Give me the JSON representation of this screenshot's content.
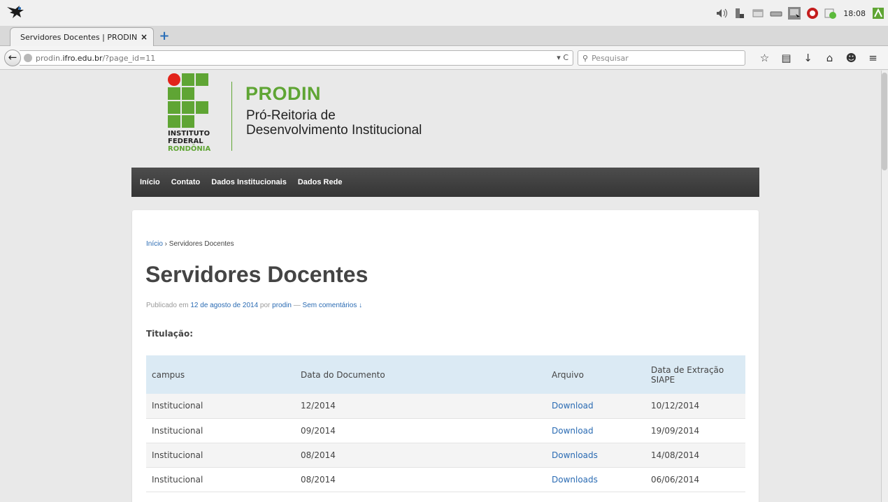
{
  "os": {
    "clock": "18:08"
  },
  "browser": {
    "tab_title": "Servidores Docentes | PRODIN",
    "tab_close": "×",
    "new_tab": "+",
    "url_prefix": "prodin.",
    "url_host": "ifro.edu.br",
    "url_path": "/?page_id=11",
    "url_actions": "▾ C",
    "search_placeholder": "Pesquisar"
  },
  "site": {
    "brand": "PRODIN",
    "subtitle_line1": "Pró-Reitoria de",
    "subtitle_line2": "Desenvolvimento Institucional",
    "institute_line1": "INSTITUTO",
    "institute_line2": "FEDERAL",
    "institute_line3": "RONDÔNIA",
    "menu": [
      "Início",
      "Contato",
      "Dados Institucionais",
      "Dados Rede"
    ],
    "colors": {
      "brand_green": "#5fa534",
      "menu_bg": "#3f3f3f",
      "link": "#2a6bb3",
      "logo_red": "#e2231a"
    }
  },
  "page": {
    "breadcrumb_home": "Início",
    "breadcrumb_sep": " › ",
    "breadcrumb_current": "Servidores Docentes",
    "title": "Servidores Docentes",
    "meta_published": "Publicado em ",
    "meta_date": "12 de agosto de 2014",
    "meta_by": " por ",
    "meta_author": "prodin",
    "meta_dash": " — ",
    "meta_comments": "Sem comentários ↓",
    "section_label": "Titulação:",
    "table": {
      "headers": [
        "campus",
        "Data do Documento",
        "Arquivo",
        "Data de Extração SIAPE"
      ],
      "rows": [
        [
          "Institucional",
          "12/2014",
          "Download",
          "10/12/2014"
        ],
        [
          "Institucional",
          "09/2014",
          "Download",
          "19/09/2014"
        ],
        [
          "Institucional",
          "08/2014",
          "Downloads",
          "14/08/2014"
        ],
        [
          "Institucional",
          "08/2014",
          "Downloads",
          "06/06/2014"
        ]
      ]
    }
  }
}
